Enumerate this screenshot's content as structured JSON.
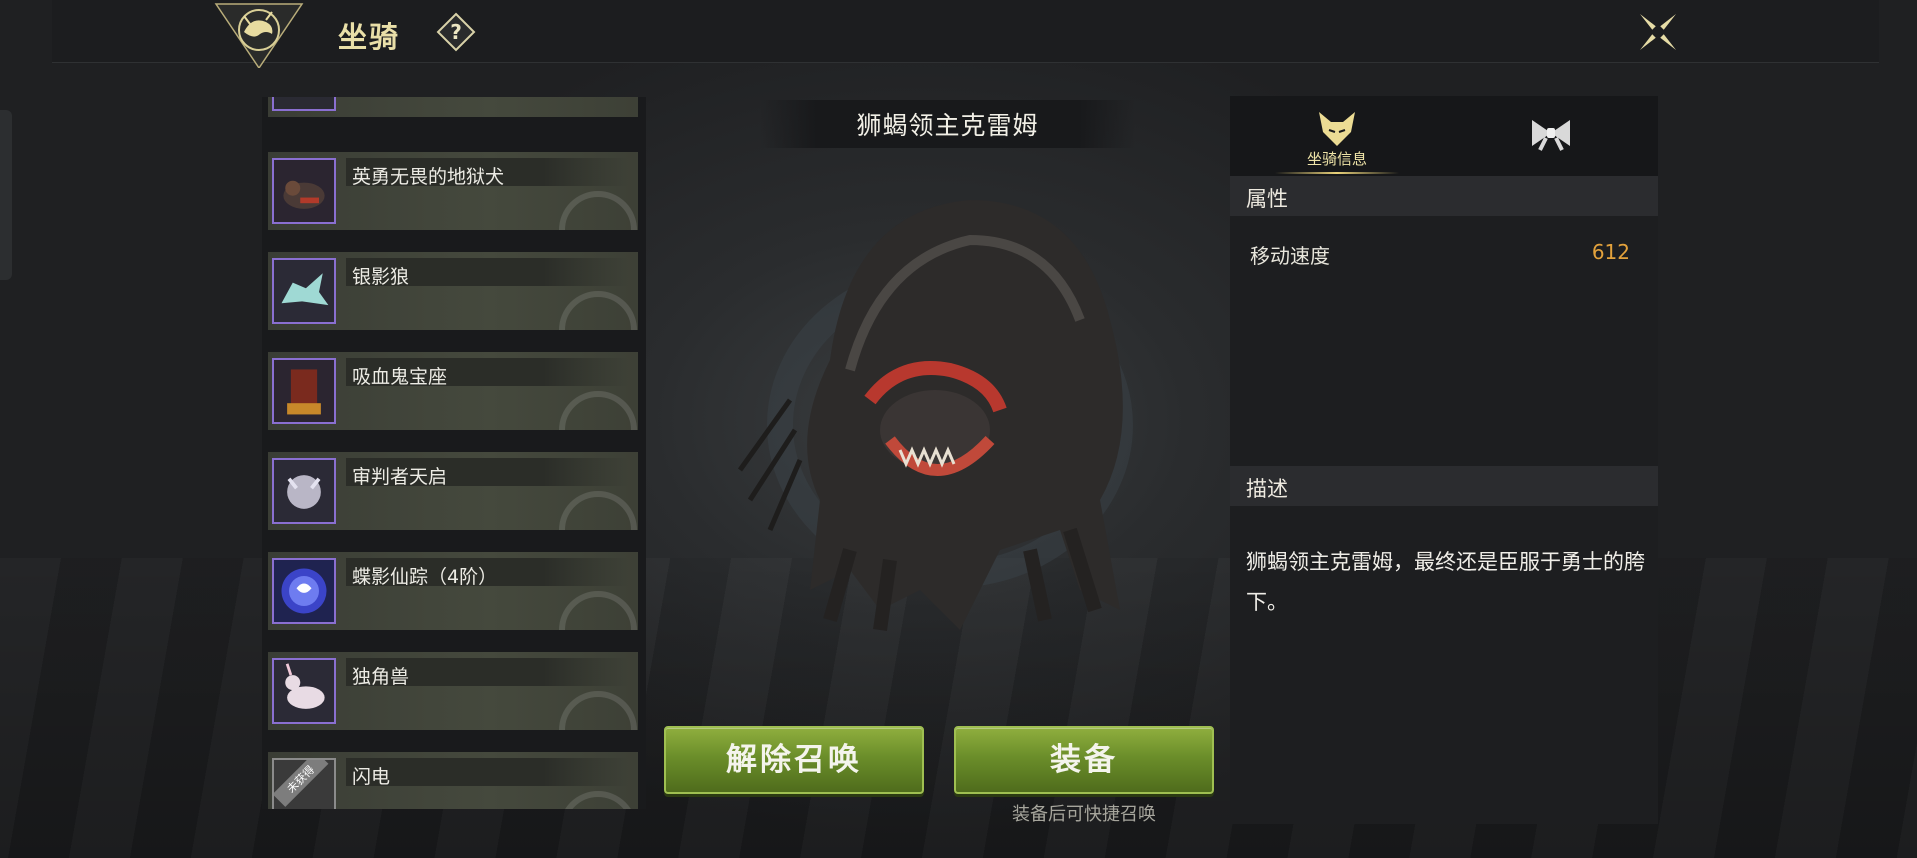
{
  "header": {
    "title": "坐骑",
    "help_symbol": "?"
  },
  "mount_list": [
    {
      "name": "英勇无畏的地狱犬",
      "locked": false
    },
    {
      "name": "银影狼",
      "locked": false
    },
    {
      "name": "吸血鬼宝座",
      "locked": false
    },
    {
      "name": "审判者天启",
      "locked": false
    },
    {
      "name": "蝶影仙踪（4阶）",
      "locked": false
    },
    {
      "name": "独角兽",
      "locked": false
    },
    {
      "name": "闪电",
      "locked": true,
      "badge": "未获得"
    }
  ],
  "selected_mount": {
    "name": "狮蝎领主克雷姆"
  },
  "actions": {
    "unsummon_label": "解除召唤",
    "equip_label": "装备",
    "equip_hint": "装备后可快捷召唤"
  },
  "info_panel": {
    "tabs": [
      {
        "label": "坐骑信息",
        "icon": "fox-head-icon",
        "active": true
      },
      {
        "label": "",
        "icon": "bow-icon",
        "active": false
      }
    ],
    "attributes_header": "属性",
    "attributes": [
      {
        "name": "移动速度",
        "value": "612"
      }
    ],
    "description_header": "描述",
    "description": "狮蝎领主克雷姆，最终还是臣服于勇士的胯下。"
  },
  "colors": {
    "accent_gold": "#e9d27a",
    "button_green": "#6b8e2a",
    "value_orange": "#e3a23c",
    "thumb_border_purple": "#8a6fd1"
  }
}
